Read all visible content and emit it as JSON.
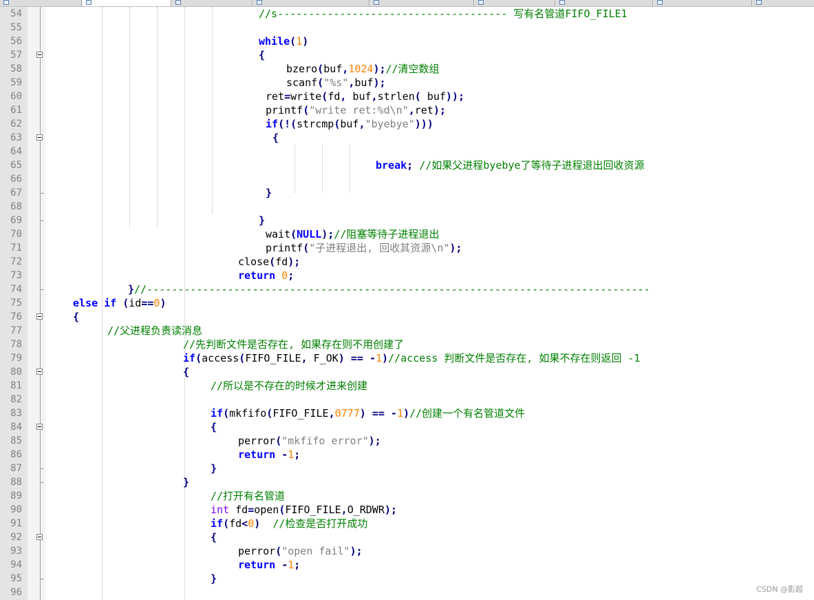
{
  "watermark": "CSDN @影超",
  "colors": {
    "keyword": "#0000ff",
    "type": "#8000ff",
    "number": "#ff8000",
    "string": "#808080",
    "operator": "#000080",
    "comment": "#008000",
    "line_number": "#808080",
    "gutter_bg": "#e4e4e4"
  },
  "lines": [
    {
      "n": "54",
      "fold": "line",
      "indent": 27,
      "tokens": [
        [
          "cm",
          "//s------------------------------------- 写有名管道FIFO_FILE1"
        ]
      ]
    },
    {
      "n": "55",
      "fold": "line",
      "indent": 0,
      "tokens": []
    },
    {
      "n": "56",
      "fold": "line",
      "indent": 27,
      "tokens": [
        [
          "kw",
          "while"
        ],
        [
          "op",
          "("
        ],
        [
          "num",
          "1"
        ],
        [
          "op",
          ")"
        ]
      ]
    },
    {
      "n": "57",
      "fold": "box",
      "indent": 27,
      "tokens": [
        [
          "op",
          "{"
        ]
      ]
    },
    {
      "n": "58",
      "fold": "line",
      "indent": 31,
      "tokens": [
        [
          "t",
          "bzero"
        ],
        [
          "op",
          "("
        ],
        [
          "t",
          "buf"
        ],
        [
          "op",
          ","
        ],
        [
          "num",
          "1024"
        ],
        [
          "op",
          ");"
        ],
        [
          "cm",
          "//清空数组"
        ]
      ]
    },
    {
      "n": "59",
      "fold": "line",
      "indent": 31,
      "tokens": [
        [
          "t",
          "scanf"
        ],
        [
          "op",
          "("
        ],
        [
          "str",
          "\"%s\""
        ],
        [
          "op",
          ","
        ],
        [
          "t",
          "buf"
        ],
        [
          "op",
          ");"
        ]
      ]
    },
    {
      "n": "60",
      "fold": "line",
      "indent": 28,
      "tokens": [
        [
          "t",
          "ret"
        ],
        [
          "op",
          "="
        ],
        [
          "t",
          "write"
        ],
        [
          "op",
          "("
        ],
        [
          "t",
          "fd"
        ],
        [
          "op",
          ","
        ],
        [
          "t",
          " buf"
        ],
        [
          "op",
          ","
        ],
        [
          "t",
          "strlen"
        ],
        [
          "op",
          "("
        ],
        [
          "t",
          " buf"
        ],
        [
          "op",
          "));"
        ]
      ]
    },
    {
      "n": "61",
      "fold": "line",
      "indent": 28,
      "tokens": [
        [
          "t",
          "printf"
        ],
        [
          "op",
          "("
        ],
        [
          "str",
          "\"write ret:%d\\n\""
        ],
        [
          "op",
          ","
        ],
        [
          "t",
          "ret"
        ],
        [
          "op",
          ");"
        ]
      ]
    },
    {
      "n": "62",
      "fold": "line",
      "indent": 28,
      "tokens": [
        [
          "kw",
          "if"
        ],
        [
          "op",
          "(!("
        ],
        [
          "t",
          "strcmp"
        ],
        [
          "op",
          "("
        ],
        [
          "t",
          "buf"
        ],
        [
          "op",
          ","
        ],
        [
          "str",
          "\"byebye\""
        ],
        [
          "op",
          ")))"
        ]
      ]
    },
    {
      "n": "63",
      "fold": "box",
      "indent": 29,
      "tokens": [
        [
          "op",
          "{"
        ]
      ]
    },
    {
      "n": "64",
      "fold": "line",
      "indent": 0,
      "tokens": []
    },
    {
      "n": "65",
      "fold": "line",
      "indent": 44,
      "tokens": [
        [
          "kw",
          "break"
        ],
        [
          "op",
          ";"
        ],
        [
          "cm",
          " //如果父进程byebye了等待子进程退出回收资源"
        ]
      ]
    },
    {
      "n": "66",
      "fold": "line",
      "indent": 0,
      "tokens": []
    },
    {
      "n": "67",
      "fold": "tick",
      "indent": 28,
      "tokens": [
        [
          "op",
          "}"
        ]
      ]
    },
    {
      "n": "68",
      "fold": "line",
      "indent": 0,
      "tokens": []
    },
    {
      "n": "69",
      "fold": "tick",
      "indent": 27,
      "tokens": [
        [
          "op",
          "}"
        ]
      ]
    },
    {
      "n": "70",
      "fold": "line",
      "indent": 28,
      "tokens": [
        [
          "t",
          "wait"
        ],
        [
          "op",
          "("
        ],
        [
          "kw",
          "NULL"
        ],
        [
          "op",
          ");"
        ],
        [
          "cm",
          "//阻塞等待子进程退出"
        ]
      ]
    },
    {
      "n": "71",
      "fold": "line",
      "indent": 28,
      "tokens": [
        [
          "t",
          "printf"
        ],
        [
          "op",
          "("
        ],
        [
          "str",
          "\"子进程退出, 回收其资源\\n\""
        ],
        [
          "op",
          ");"
        ]
      ]
    },
    {
      "n": "72",
      "fold": "line",
      "indent": 24,
      "tokens": [
        [
          "t",
          "close"
        ],
        [
          "op",
          "("
        ],
        [
          "t",
          "fd"
        ],
        [
          "op",
          ");"
        ]
      ]
    },
    {
      "n": "73",
      "fold": "line",
      "indent": 24,
      "tokens": [
        [
          "kw",
          "return"
        ],
        [
          "num",
          " 0"
        ],
        [
          "op",
          ";"
        ]
      ]
    },
    {
      "n": "74",
      "fold": "tick",
      "indent": 8,
      "tokens": [
        [
          "op",
          "}"
        ],
        [
          "cm",
          "//---------------------------------------------------------------------------------"
        ]
      ]
    },
    {
      "n": "75",
      "fold": "line",
      "indent": 0,
      "tokens": [
        [
          "kw",
          "else"
        ],
        [
          "t",
          " "
        ],
        [
          "kw",
          "if"
        ],
        [
          "t",
          " "
        ],
        [
          "op",
          "("
        ],
        [
          "t",
          "id"
        ],
        [
          "op",
          "=="
        ],
        [
          "num",
          "0"
        ],
        [
          "op",
          ")"
        ]
      ]
    },
    {
      "n": "76",
      "fold": "box",
      "indent": 0,
      "tokens": [
        [
          "op",
          "{"
        ]
      ]
    },
    {
      "n": "77",
      "fold": "line",
      "indent": 5,
      "tokens": [
        [
          "cm",
          "//父进程负责读消息"
        ]
      ]
    },
    {
      "n": "78",
      "fold": "line",
      "indent": 16,
      "tokens": [
        [
          "cm",
          "//先判断文件是否存在, 如果存在则不用创建了"
        ]
      ]
    },
    {
      "n": "79",
      "fold": "line",
      "indent": 16,
      "tokens": [
        [
          "kw",
          "if"
        ],
        [
          "op",
          "("
        ],
        [
          "t",
          "access"
        ],
        [
          "op",
          "("
        ],
        [
          "t",
          "FIFO_FILE"
        ],
        [
          "op",
          ","
        ],
        [
          "t",
          " F_OK"
        ],
        [
          "op",
          ")"
        ],
        [
          "t",
          " "
        ],
        [
          "op",
          "=="
        ],
        [
          "t",
          " "
        ],
        [
          "op",
          "-"
        ],
        [
          "num",
          "1"
        ],
        [
          "op",
          ")"
        ],
        [
          "cm",
          "//access 判断文件是否存在, 如果不存在则返回 -1"
        ]
      ]
    },
    {
      "n": "80",
      "fold": "box",
      "indent": 16,
      "tokens": [
        [
          "op",
          "{"
        ]
      ]
    },
    {
      "n": "81",
      "fold": "line",
      "indent": 20,
      "tokens": [
        [
          "cm",
          "//所以是不存在的时候才进来创建"
        ]
      ]
    },
    {
      "n": "82",
      "fold": "line",
      "indent": 0,
      "tokens": []
    },
    {
      "n": "83",
      "fold": "line",
      "indent": 20,
      "tokens": [
        [
          "kw",
          "if"
        ],
        [
          "op",
          "("
        ],
        [
          "t",
          "mkfifo"
        ],
        [
          "op",
          "("
        ],
        [
          "t",
          "FIFO_FILE"
        ],
        [
          "op",
          ","
        ],
        [
          "num",
          "0777"
        ],
        [
          "op",
          ")"
        ],
        [
          "t",
          " "
        ],
        [
          "op",
          "=="
        ],
        [
          "t",
          " "
        ],
        [
          "op",
          "-"
        ],
        [
          "num",
          "1"
        ],
        [
          "op",
          ")"
        ],
        [
          "cm",
          "//创建一个有名管道文件"
        ]
      ]
    },
    {
      "n": "84",
      "fold": "box",
      "indent": 20,
      "tokens": [
        [
          "op",
          "{"
        ]
      ]
    },
    {
      "n": "85",
      "fold": "line",
      "indent": 24,
      "tokens": [
        [
          "t",
          "perror"
        ],
        [
          "op",
          "("
        ],
        [
          "str",
          "\"mkfifo error\""
        ],
        [
          "op",
          ");"
        ]
      ]
    },
    {
      "n": "86",
      "fold": "line",
      "indent": 24,
      "tokens": [
        [
          "kw",
          "return"
        ],
        [
          "t",
          " "
        ],
        [
          "op",
          "-"
        ],
        [
          "num",
          "1"
        ],
        [
          "op",
          ";"
        ]
      ]
    },
    {
      "n": "87",
      "fold": "tick",
      "indent": 20,
      "tokens": [
        [
          "op",
          "}"
        ]
      ]
    },
    {
      "n": "88",
      "fold": "tick",
      "indent": 16,
      "tokens": [
        [
          "op",
          "}"
        ]
      ]
    },
    {
      "n": "89",
      "fold": "line",
      "indent": 20,
      "tokens": [
        [
          "cm",
          "//打开有名管道"
        ]
      ]
    },
    {
      "n": "90",
      "fold": "line",
      "indent": 20,
      "tokens": [
        [
          "ty",
          "int"
        ],
        [
          "t",
          " fd"
        ],
        [
          "op",
          "="
        ],
        [
          "t",
          "open"
        ],
        [
          "op",
          "("
        ],
        [
          "t",
          "FIFO_FILE"
        ],
        [
          "op",
          ","
        ],
        [
          "t",
          "O_RDWR"
        ],
        [
          "op",
          ");"
        ]
      ]
    },
    {
      "n": "91",
      "fold": "line",
      "indent": 20,
      "tokens": [
        [
          "kw",
          "if"
        ],
        [
          "op",
          "("
        ],
        [
          "t",
          "fd"
        ],
        [
          "op",
          "<"
        ],
        [
          "num",
          "0"
        ],
        [
          "op",
          ")"
        ],
        [
          "t",
          "  "
        ],
        [
          "cm",
          "//检查是否打开成功"
        ]
      ]
    },
    {
      "n": "92",
      "fold": "box",
      "indent": 20,
      "tokens": [
        [
          "op",
          "{"
        ]
      ]
    },
    {
      "n": "93",
      "fold": "line",
      "indent": 24,
      "tokens": [
        [
          "t",
          "perror"
        ],
        [
          "op",
          "("
        ],
        [
          "str",
          "\"open fail\""
        ],
        [
          "op",
          ");"
        ]
      ]
    },
    {
      "n": "94",
      "fold": "line",
      "indent": 24,
      "tokens": [
        [
          "kw",
          "return"
        ],
        [
          "t",
          " "
        ],
        [
          "op",
          "-"
        ],
        [
          "num",
          "1"
        ],
        [
          "op",
          ";"
        ]
      ]
    },
    {
      "n": "95",
      "fold": "tick",
      "indent": 20,
      "tokens": [
        [
          "op",
          "}"
        ]
      ]
    },
    {
      "n": "96",
      "fold": "line",
      "indent": 0,
      "tokens": []
    }
  ]
}
